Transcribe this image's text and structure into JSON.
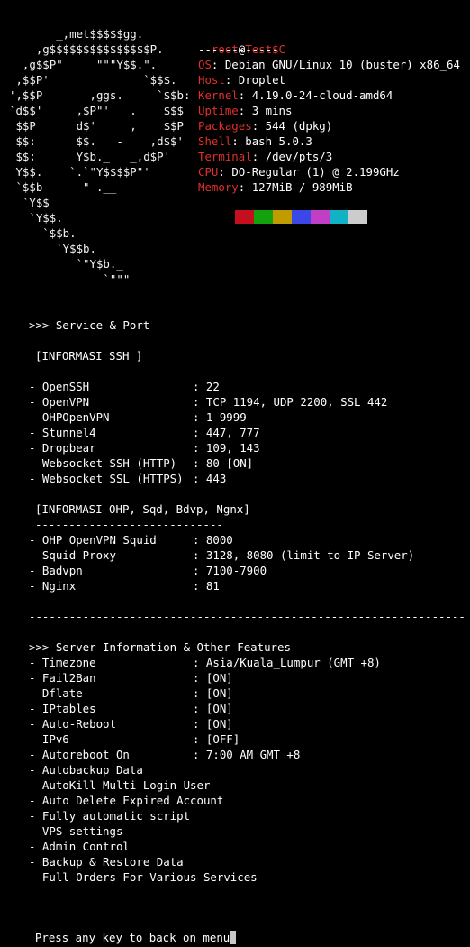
{
  "colors": {
    "background": "#000000",
    "text": "#ffffff",
    "accent_red": "#e0302a",
    "palette": [
      "#000000",
      "#c50f1f",
      "#13a10e",
      "#c19c00",
      "#3b48e8",
      "#c13ec6",
      "#11b2c6",
      "#cccccc"
    ]
  },
  "ascii_art": [
    "       _,met$$$$$gg.",
    "    ,g$$$$$$$$$$$$$$$P.",
    "  ,g$$P\"     \"\"\"Y$$.\".",
    " ,$$P'              `$$$.",
    "',$$P       ,ggs.     `$$b:",
    "`d$$'     ,$P\"'   .    $$$",
    " $$P      d$'     ,    $$P",
    " $$:      $$.   -    ,d$$'",
    " $$;      Y$b._   _,d$P'",
    " Y$$.    `.`\"Y$$$$P\"'",
    " `$$b      \"-.__",
    "  `Y$$",
    "   `Y$$.",
    "     `$$b.",
    "       `Y$$b.",
    "          `\"Y$b._",
    "              `\"\"\""
  ],
  "sysinfo": {
    "user": "root",
    "at": "@",
    "host": "Test$C",
    "separator": "------------",
    "rows": [
      {
        "key": "OS",
        "value": "Debian GNU/Linux 10 (buster) x86_64"
      },
      {
        "key": "Host",
        "value": "Droplet"
      },
      {
        "key": "Kernel",
        "value": "4.19.0-24-cloud-amd64"
      },
      {
        "key": "Uptime",
        "value": "3 mins"
      },
      {
        "key": "Packages",
        "value": "544 (dpkg)"
      },
      {
        "key": "Shell",
        "value": "bash 5.0.3"
      },
      {
        "key": "Terminal",
        "value": "/dev/pts/3"
      },
      {
        "key": "CPU",
        "value": "DO-Regular (1) @ 2.199GHz"
      },
      {
        "key": "Memory",
        "value": "127MiB / 989MiB"
      }
    ]
  },
  "service_port": {
    "header": ">>> Service & Port",
    "ssh_section": {
      "title": "[INFORMASI SSH ]",
      "underline": "---------------------------",
      "items": [
        {
          "name": "- OpenSSH",
          "value": ": 22"
        },
        {
          "name": "- OpenVPN",
          "value": ": TCP 1194, UDP 2200, SSL 442"
        },
        {
          "name": "- OHPOpenVPN",
          "value": ": 1-9999"
        },
        {
          "name": "- Stunnel4",
          "value": ": 447, 777"
        },
        {
          "name": "- Dropbear",
          "value": ": 109, 143"
        },
        {
          "name": "- Websocket SSH (HTTP)",
          "value": ": 80 [ON]"
        },
        {
          "name": "- Websocket SSL (HTTPS)",
          "value": ": 443"
        }
      ]
    },
    "ohp_section": {
      "title": "[INFORMASI OHP, Sqd, Bdvp, Ngnx]",
      "underline": "----------------------------",
      "items": [
        {
          "name": "- OHP OpenVPN Squid",
          "value": ": 8000"
        },
        {
          "name": "- Squid Proxy",
          "value": ": 3128, 8080 (limit to IP Server)"
        },
        {
          "name": "- Badvpn",
          "value": ": 7100-7900"
        },
        {
          "name": "- Nginx",
          "value": ": 81"
        }
      ]
    }
  },
  "divider": "-----------------------------------------------------------------",
  "server_info": {
    "header": ">>> Server Information & Other Features",
    "items": [
      {
        "name": "- Timezone",
        "value": ": Asia/Kuala_Lumpur (GMT +8)"
      },
      {
        "name": "- Fail2Ban",
        "value": ": [ON]"
      },
      {
        "name": "- Dflate",
        "value": ": [ON]"
      },
      {
        "name": "- IPtables",
        "value": ": [ON]"
      },
      {
        "name": "- Auto-Reboot",
        "value": ": [ON]"
      },
      {
        "name": "- IPv6",
        "value": ": [OFF]"
      },
      {
        "name": "- Autoreboot On",
        "value": ": 7:00 AM GMT +8"
      },
      {
        "name": "- Autobackup Data",
        "value": ""
      },
      {
        "name": "- AutoKill Multi Login User",
        "value": ""
      },
      {
        "name": "- Auto Delete Expired Account",
        "value": ""
      },
      {
        "name": "- Fully automatic script",
        "value": ""
      },
      {
        "name": "- VPS settings",
        "value": ""
      },
      {
        "name": "- Admin Control",
        "value": ""
      },
      {
        "name": "- Backup & Restore Data",
        "value": ""
      },
      {
        "name": "- Full Orders For Various Services",
        "value": ""
      }
    ]
  },
  "prompt": "Press any key to back on menu"
}
